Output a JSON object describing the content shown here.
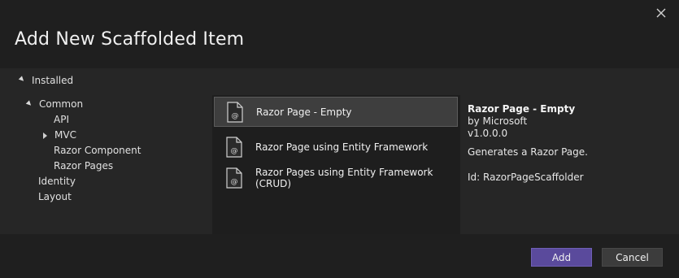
{
  "dialog": {
    "title": "Add New Scaffolded Item",
    "close_icon": "close-icon"
  },
  "tree": {
    "root": "Installed",
    "items": [
      {
        "label": "Common",
        "expander": "expanded"
      },
      {
        "label": "API",
        "expander": "none"
      },
      {
        "label": "MVC",
        "expander": "collapsed"
      },
      {
        "label": "Razor Component",
        "expander": "none"
      },
      {
        "label": "Razor Pages",
        "expander": "none"
      },
      {
        "label": "Identity",
        "expander": "none"
      },
      {
        "label": "Layout",
        "expander": "none"
      }
    ]
  },
  "templates": [
    {
      "label": "Razor Page - Empty",
      "icon": "razor-file-icon",
      "selected": true
    },
    {
      "label": "Razor Page using Entity Framework",
      "icon": "razor-file-icon",
      "selected": false
    },
    {
      "label": "Razor Pages using Entity Framework (CRUD)",
      "icon": "razor-file-icon",
      "selected": false
    }
  ],
  "details": {
    "title": "Razor Page - Empty",
    "author": "by Microsoft",
    "version": "v1.0.0.0",
    "description": "Generates a Razor Page.",
    "id": "Id: RazorPageScaffolder"
  },
  "buttons": {
    "add": "Add",
    "cancel": "Cancel"
  },
  "colors": {
    "background": "#1f1f1f",
    "panel": "#262626",
    "selected_item": "#3e3e3e",
    "primary_button": "#5a4a9c"
  }
}
